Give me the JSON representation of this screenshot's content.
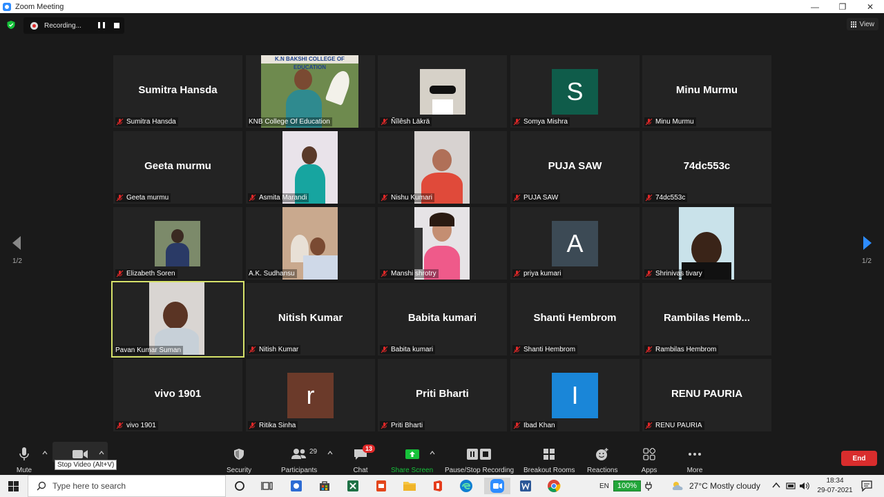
{
  "window": {
    "title": "Zoom Meeting",
    "controls": [
      "—",
      "❐",
      "✕"
    ]
  },
  "topbar": {
    "recording_label": "Recording...",
    "view_label": "View"
  },
  "pager": {
    "left_label": "1/2",
    "right_label": "1/2"
  },
  "participants": [
    {
      "name": "Sumitra Hansda",
      "display": "Sumitra Hansda",
      "kind": "name",
      "muted": true
    },
    {
      "name": "KNB College Of Education",
      "kind": "video",
      "muted": false
    },
    {
      "name": "Ñîlêsh Läkrä",
      "kind": "video",
      "muted": true
    },
    {
      "name": "Somya Mishra",
      "kind": "letter",
      "letter": "S",
      "color": "#0f5c4a",
      "muted": true
    },
    {
      "name": "Minu Murmu",
      "display": "Minu Murmu",
      "kind": "name",
      "muted": true
    },
    {
      "name": "Geeta murmu",
      "display": "Geeta murmu",
      "kind": "name",
      "muted": true
    },
    {
      "name": "Asmita Marandi",
      "kind": "video",
      "muted": true
    },
    {
      "name": "Nishu Kumari",
      "kind": "video",
      "muted": true
    },
    {
      "name": "PUJA SAW",
      "display": "PUJA SAW",
      "kind": "name",
      "muted": true
    },
    {
      "name": "74dc553c",
      "display": "74dc553c",
      "kind": "name",
      "muted": true
    },
    {
      "name": "Elizabeth Soren",
      "kind": "video",
      "muted": true
    },
    {
      "name": "A.K. Sudhansu",
      "kind": "video",
      "muted": false
    },
    {
      "name": "Manshi shrotry",
      "kind": "video",
      "muted": true
    },
    {
      "name": "priya kumari",
      "kind": "letter",
      "letter": "A",
      "color": "#3c4a55",
      "muted": true
    },
    {
      "name": "Shrinivas tivary",
      "kind": "video",
      "muted": true
    },
    {
      "name": "Pavan Kumar Suman",
      "kind": "video",
      "muted": false,
      "active": true
    },
    {
      "name": "Nitish Kumar",
      "display": "Nitish Kumar",
      "kind": "name",
      "muted": true
    },
    {
      "name": "Babita kumari",
      "display": "Babita kumari",
      "kind": "name",
      "muted": true
    },
    {
      "name": "Shanti Hembrom",
      "display": "Shanti Hembrom",
      "kind": "name",
      "muted": true
    },
    {
      "name": "Rambilas Hembrom",
      "display": "Rambilas  Hemb...",
      "kind": "name",
      "muted": true
    },
    {
      "name": "vivo 1901",
      "display": "vivo 1901",
      "kind": "name",
      "muted": true
    },
    {
      "name": "Ritika Sinha",
      "kind": "letter",
      "letter": "r",
      "color": "#6b3a2a",
      "muted": true
    },
    {
      "name": "Priti Bharti",
      "display": "Priti Bharti",
      "kind": "name",
      "muted": true
    },
    {
      "name": "Ibad Khan",
      "kind": "letter",
      "letter": "I",
      "color": "#1a86d8",
      "muted": true
    },
    {
      "name": "RENU PAURIA",
      "display": "RENU PAURIA",
      "kind": "name",
      "muted": true
    }
  ],
  "video_scene": {
    "knb_banner": "K.N BAKSHI COLLEGE OF EDUCATION"
  },
  "toolbar": {
    "mute": "Mute",
    "stop_video_tooltip": "Stop Video (Alt+V)",
    "security": "Security",
    "participants": "Participants",
    "participants_count": "29",
    "chat": "Chat",
    "chat_badge": "13",
    "share_screen": "Share Screen",
    "pause_stop_recording": "Pause/Stop Recording",
    "breakout_rooms": "Breakout Rooms",
    "reactions": "Reactions",
    "apps": "Apps",
    "more": "More",
    "end": "End"
  },
  "taskbar": {
    "search_placeholder": "Type here to search",
    "lang": "EN",
    "battery": "100%",
    "weather": "27°C  Mostly cloudy",
    "time": "18:34",
    "date": "29-07-2021"
  },
  "colors": {
    "accent_green": "#16c23a",
    "end_red": "#d92d2d",
    "active_border": "#d6e26a",
    "arrow_blue": "#2d8cff"
  }
}
